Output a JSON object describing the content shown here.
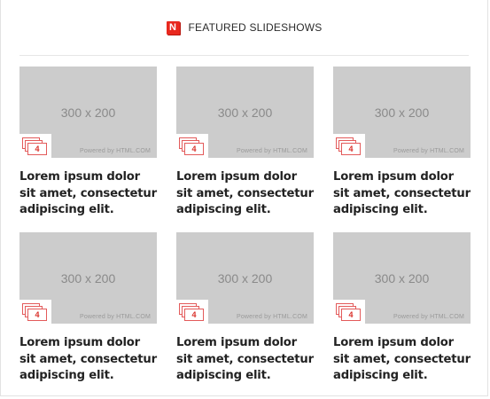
{
  "header": {
    "logo_letter": "N",
    "title": "FEATURED SLIDESHOWS"
  },
  "slideshows": [
    {
      "placeholder": "300 x 200",
      "powered_by": "Powered by HTML.COM",
      "count": "4",
      "caption": "Lorem ipsum dolor sit amet, consectetur adipiscing elit."
    },
    {
      "placeholder": "300 x 200",
      "powered_by": "Powered by HTML.COM",
      "count": "4",
      "caption": "Lorem ipsum dolor sit amet, consectetur adipiscing elit."
    },
    {
      "placeholder": "300 x 200",
      "powered_by": "Powered by HTML.COM",
      "count": "4",
      "caption": "Lorem ipsum dolor sit amet, consectetur adipiscing elit."
    },
    {
      "placeholder": "300 x 200",
      "powered_by": "Powered by HTML.COM",
      "count": "4",
      "caption": "Lorem ipsum dolor sit amet, consectetur adipiscing elit."
    },
    {
      "placeholder": "300 x 200",
      "powered_by": "Powered by HTML.COM",
      "count": "4",
      "caption": "Lorem ipsum dolor sit amet, consectetur adipiscing elit."
    },
    {
      "placeholder": "300 x 200",
      "powered_by": "Powered by HTML.COM",
      "count": "4",
      "caption": "Lorem ipsum dolor sit amet, consectetur adipiscing elit."
    }
  ],
  "colors": {
    "accent": "#e8281e",
    "placeholder_bg": "#cccccc",
    "caption_text": "#222222"
  },
  "icons": {
    "brand": "brand-logo-icon",
    "slides": "slide-stack-icon"
  }
}
